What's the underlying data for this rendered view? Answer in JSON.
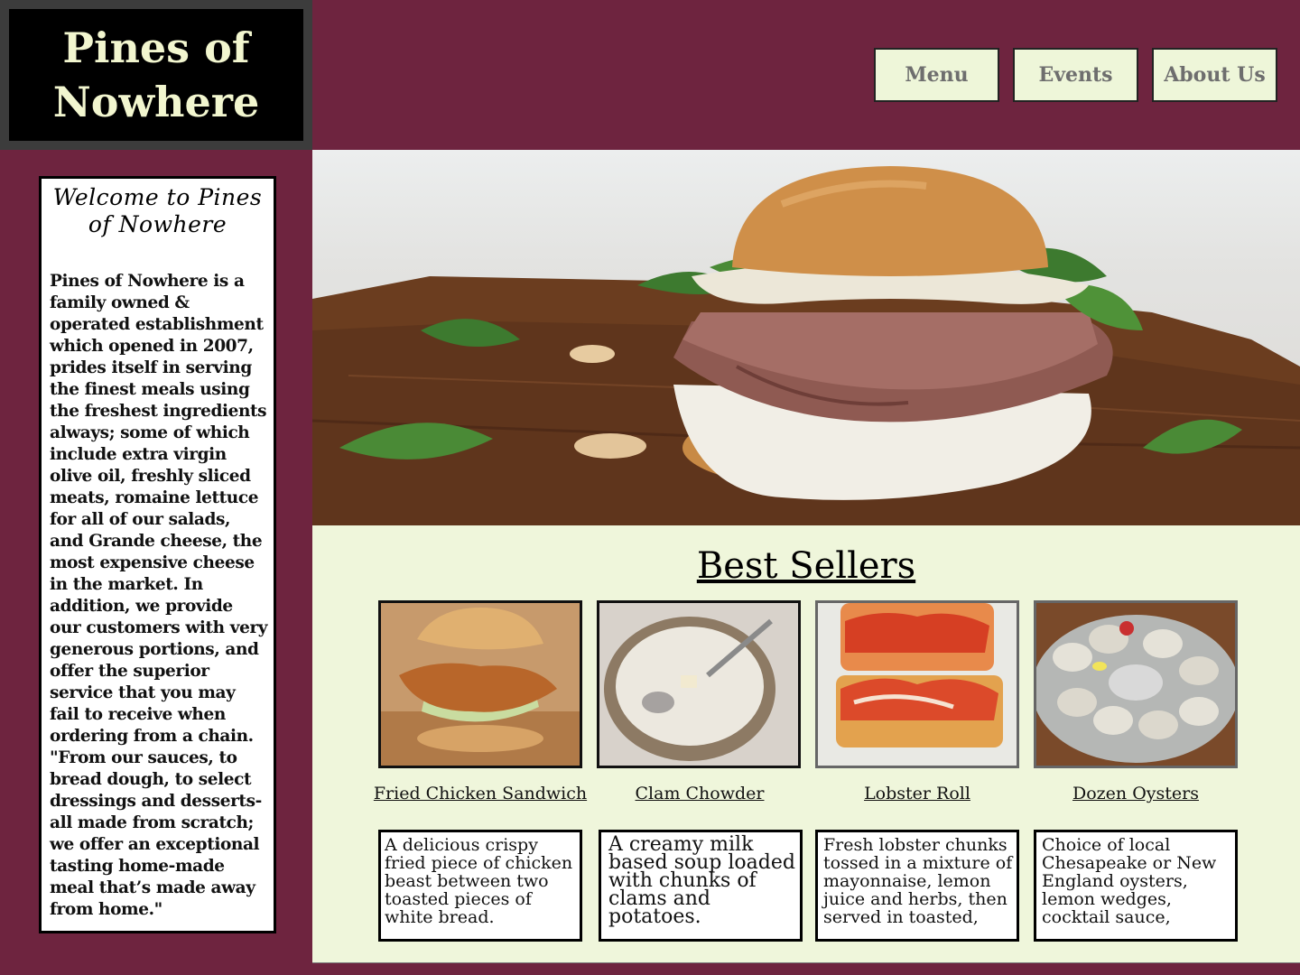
{
  "logo": {
    "text": "Pines of Nowhere"
  },
  "nav": {
    "menu_label": "Menu",
    "events_label": "Events",
    "about_label": "About Us"
  },
  "sidebar": {
    "welcome_title": "Welcome to Pines of Nowhere",
    "welcome_body": "Pines of Nowhere is a family owned & operated establishment which opened in 2007, prides itself in serving the finest meals using the freshest ingredients always; some of which include extra virgin olive oil, freshly sliced meats, romaine lettuce for all of our salads, and Grande cheese, the most expensive cheese in the market. In addition, we provide our customers with very generous portions, and offer the superior service that you may fail to receive when ordering from a chain. \"From our sauces, to bread dough, to select dressings and desserts- all made from scratch; we offer an exceptional tasting home-made meal that’s made away from home.\""
  },
  "best_sellers": {
    "title": "Best Sellers",
    "items": [
      {
        "name": "Fried Chicken Sandwich",
        "desc": "A delicious crispy fried piece of chicken beast between two toasted pieces of white bread."
      },
      {
        "name": "Clam Chowder",
        "desc": "A creamy milk based soup loaded with chunks of clams and potatoes."
      },
      {
        "name": "Lobster Roll",
        "desc": "Fresh lobster chunks tossed in a mixture of mayonnaise, lemon juice and herbs, then served in toasted,"
      },
      {
        "name": "Dozen Oysters",
        "desc": "Choice of local Chesapeake or New England oysters, lemon wedges, cocktail sauce,"
      }
    ]
  },
  "colors": {
    "brand_maroon": "#6e243f",
    "cream": "#f2f6cf",
    "content_bg": "#eff6db"
  }
}
